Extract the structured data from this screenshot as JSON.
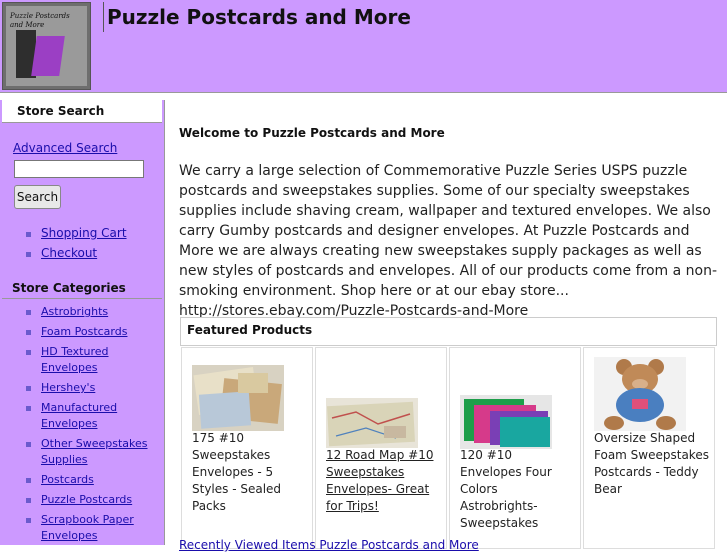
{
  "header": {
    "logo_text": "Puzzle Postcards and More",
    "site_title": "Puzzle Postcards and More"
  },
  "sidebar": {
    "search_heading": "Store Search",
    "advanced_search": "Advanced Search",
    "search_value": "",
    "search_button": "Search",
    "cart_links": [
      "Shopping Cart",
      "Checkout"
    ],
    "categories_heading": "Store Categories",
    "categories": [
      "Astrobrights",
      "Foam Postcards",
      "HD Textured Envelopes",
      "Hershey's",
      "Manufactured Envelopes",
      "Other Sweepstakes Supplies",
      "Postcards",
      "Puzzle Postcards",
      "Scrapbook Paper Envelopes"
    ]
  },
  "main": {
    "welcome": "Welcome to Puzzle Postcards and More",
    "intro": "We carry a large selection of Commemorative Puzzle Series USPS puzzle postcards and sweepstakes supplies. Some of our specialty sweepstakes supplies include shaving cream, wallpaper and textured envelopes. We also carry Gumby postcards and designer envelopes. At Puzzle Postcards and More we are always creating new sweepstakes supply packages as well as new styles of postcards and envelopes. All of our products come from a non-smoking environment. Shop here or at our ebay store... http://stores.ebay.com/Puzzle-Postcards-and-More",
    "featured_heading": "Featured Products",
    "products": [
      {
        "name": "175 #10 Sweepstakes Envelopes - 5 Styles - Sealed Packs",
        "is_link": false
      },
      {
        "name": "12 Road Map #10 Sweepstakes Envelopes- Great for Trips!",
        "is_link": true
      },
      {
        "name": "120 #10 Envelopes Four Colors Astrobrights- Sweepstakes",
        "is_link": false
      },
      {
        "name": "Oversize Shaped Foam Sweepstakes Postcards - Teddy Bear",
        "is_link": false
      }
    ],
    "bottom_link": "Recently Viewed Items Puzzle Postcards and More"
  },
  "colors": {
    "header_bg": "#cc99ff",
    "sidebar_bg": "#cc99ff",
    "link": "#1a0dab"
  }
}
